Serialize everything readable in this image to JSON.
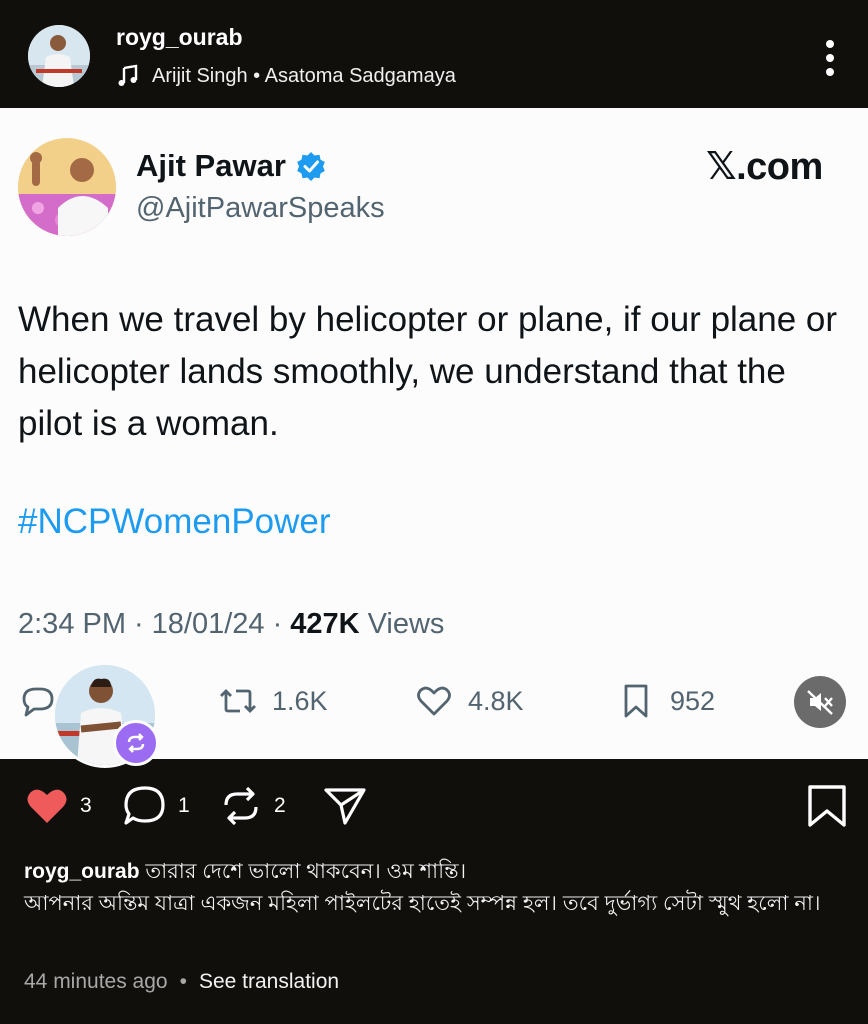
{
  "header": {
    "username": "royg_ourab",
    "music": "Arijit Singh • Asatoma Sadgamaya"
  },
  "tweet": {
    "display_name": "Ajit Pawar",
    "handle": "@AjitPawarSpeaks",
    "brand": "𝕏.com",
    "text": "When we travel by helicopter or plane, if our plane or helicopter lands smoothly, we understand that the pilot is a woman.",
    "hashtag": "#NCPWomenPower",
    "time": "2:34 PM",
    "date": "18/01/24",
    "views_count": "427K",
    "views_label": "Views",
    "reposts": "1.6K",
    "likes": "4.8K",
    "bookmarks": "952"
  },
  "post": {
    "likes": "3",
    "comments": "1",
    "reposts": "2",
    "caption_user": "royg_ourab",
    "caption_text": "তারার দেশে ভালো থাকবেন। ওম শান্তি।",
    "caption_line2": "আপনার অন্তিম যাত্রা একজন মহিলা পাইলটের হাতেই সম্পন্ন হল। তবে দুর্ভাগ্য সেটা স্মুথ হলো না।",
    "time_ago": "44 minutes ago",
    "separator": "•",
    "see_translation": "See translation"
  },
  "colors": {
    "background": "#110f0c",
    "card": "#fcfcfc",
    "like_red": "#ef5a5a",
    "link_blue": "#1d9bf0",
    "verified_blue": "#1d9bf0",
    "repost_badge": "#9b6bf2"
  },
  "icons": {
    "music": "music-note-icon",
    "more": "more-vertical-icon",
    "verified": "verified-badge-icon",
    "reply": "reply-icon",
    "retweet": "retweet-icon",
    "like": "heart-icon",
    "bookmark": "bookmark-icon",
    "mute": "mute-icon",
    "comment": "comment-icon",
    "repost": "repost-icon",
    "share": "share-icon",
    "save": "save-icon"
  }
}
